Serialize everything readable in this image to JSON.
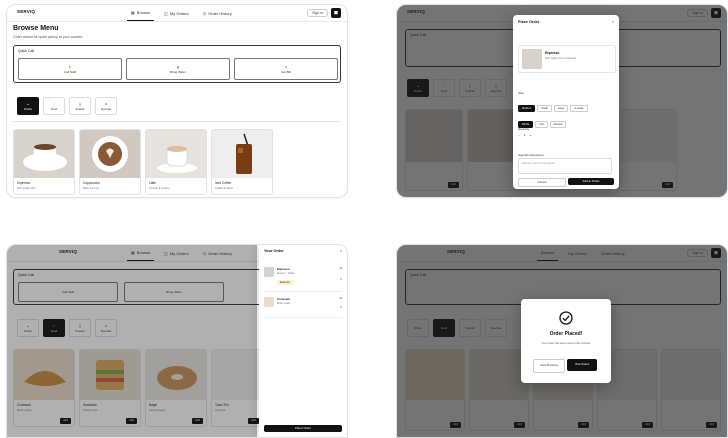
{
  "brand": "SERVIQ",
  "nav": {
    "tab1": "Browse",
    "tab2": "My Orders",
    "tab3": "Order History",
    "pill": "Sign in",
    "square_icon": "bag-icon"
  },
  "browse": {
    "title": "Browse Menu",
    "subtitle": "Order ahead for quick pickup at your counter.",
    "quick_label": "Quick Call",
    "quick": [
      "Call Staff",
      "Bring Water",
      "Get Bill"
    ],
    "categories": [
      "Drinks",
      "Food",
      "Snacks",
      "Specials"
    ],
    "active_category": 0,
    "drinks": [
      {
        "name": "Espresso",
        "desc": "Rich single shot",
        "color": "#d8d2cc"
      },
      {
        "name": "Cappuccino",
        "desc": "Milky foam art",
        "color": "#cfc9c2"
      },
      {
        "name": "Latte",
        "desc": "Smooth & creamy",
        "color": "#e6e3df"
      },
      {
        "name": "Iced Coffee",
        "desc": "Chilled & sweet",
        "color": "#eeeeee"
      }
    ],
    "food": [
      {
        "name": "Croissant",
        "desc": "Butter pastry",
        "color": "#e9dcc9",
        "add": "Add"
      },
      {
        "name": "Sandwich",
        "desc": "Toasted club",
        "color": "#e3dfd6",
        "add": "Add"
      },
      {
        "name": "Bagel",
        "desc": "Seeded bagel",
        "color": "#eae6e0",
        "add": "Add"
      },
      {
        "name": "Toast Trio",
        "desc": "Assorted",
        "color": "#f0f0f0",
        "add": "Add"
      }
    ],
    "add_label": "Add"
  },
  "place_order": {
    "title": "Place Order",
    "item_name": "Espresso",
    "item_desc": "Rich single shot of espresso",
    "size_label": "Size",
    "sizes": [
      "Medium",
      "Small",
      "Large",
      "X-Large"
    ],
    "milk_label": "Milk",
    "milks": [
      "Whole",
      "Oat",
      "Almond"
    ],
    "qty_label": "Quantity",
    "qty": "1",
    "notes_label": "Special instructions",
    "notes_placeholder": "Add any notes for the barista...",
    "cancel": "Cancel",
    "confirm": "Add to Order"
  },
  "order_drawer": {
    "title": "Your Order",
    "items": [
      {
        "name": "Espresso",
        "detail": "Medium · Whole",
        "price": "x1",
        "note": "Extra hot"
      },
      {
        "name": "Croissant",
        "detail": "Butter pastry",
        "price": "x1",
        "note": ""
      }
    ],
    "checkout": "Place Order"
  },
  "placed": {
    "title": "Order Placed!",
    "message": "Your order has been sent to the counter.",
    "secondary": "Keep Browsing",
    "primary": "View Orders"
  }
}
